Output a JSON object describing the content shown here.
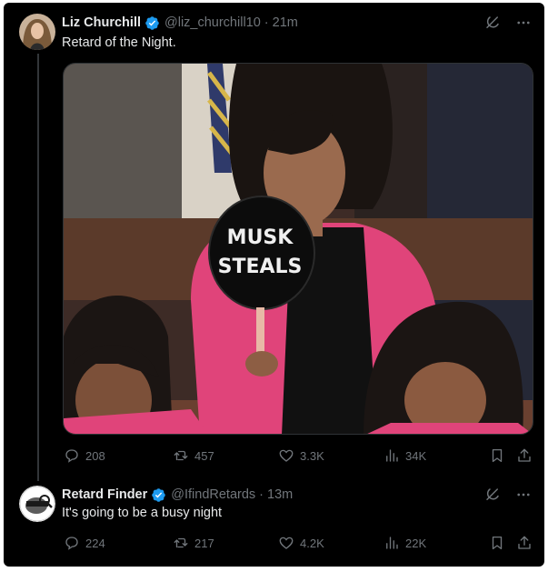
{
  "tweets": [
    {
      "author_name": "Liz Churchill",
      "handle": "@liz_churchill10",
      "separator": "·",
      "time": "21m",
      "text": "Retard of the Night.",
      "stats": {
        "replies": "208",
        "reposts": "457",
        "likes": "3.3K",
        "views": "34K"
      }
    },
    {
      "author_name": "Retard Finder",
      "handle": "@IfindRetards",
      "separator": "·",
      "time": "13m",
      "text": "It's going to be a busy night",
      "stats": {
        "replies": "224",
        "reposts": "217",
        "likes": "4.2K",
        "views": "22K"
      }
    }
  ],
  "media": {
    "sign_line1": "MUSK",
    "sign_line2": "STEALS"
  },
  "icons": [
    "verified-badge-icon",
    "grok-icon",
    "more-icon",
    "reply-icon",
    "repost-icon",
    "like-icon",
    "views-icon",
    "bookmark-icon",
    "share-icon"
  ],
  "colors": {
    "background": "#000000",
    "text": "#e7e9ea",
    "muted": "#71767b",
    "verified": "#1d9bf0",
    "jacket": "#e0447a"
  }
}
